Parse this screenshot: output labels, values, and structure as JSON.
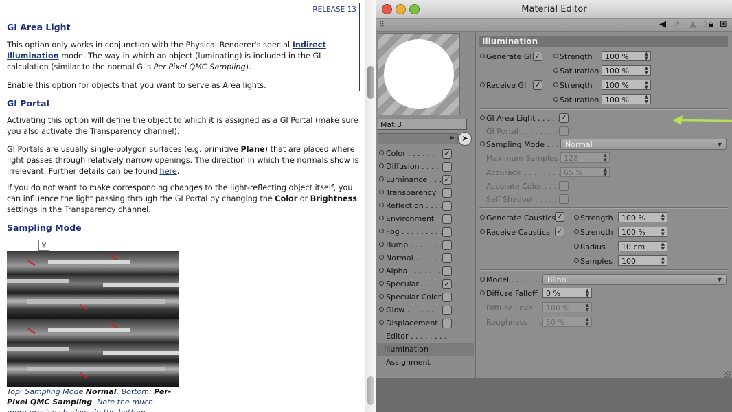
{
  "doc": {
    "release": "RELEASE 13",
    "h_area": "GI Area Light",
    "p1a": "This option only works in conjunction with the Physical Renderer's special ",
    "p1_link": "Indirect Illumination",
    "p1b": " mode. The way in which an object (luminating) is included in the GI calculation (similar to the normal GI's ",
    "p1_it": "Per Pixel QMC Sampling",
    "p1c": ").",
    "p2": "Enable this option for objects that you want to serve as Area lights.",
    "h_portal": "GI Portal",
    "p3": "Activating this option will define the object to which it is assigned as a GI Portal (make sure you also activate the Transparency channel).",
    "p4a": "GI Portals are usually single-polygon surfaces (e.g. primitive ",
    "p4_b": "Plane",
    "p4b": ") that are placed where light passes through relatively narrow openings. The direction in which the normals show is irrelevant. Further details can be found ",
    "p4_link": "here",
    "p4c": ".",
    "p5a": "If you do not want to make corresponding changes to the light-reflecting object itself, you can influence the light passing through the GI Portal by changing the ",
    "p5_b1": "Color",
    "p5_or": " or ",
    "p5_b2": "Brightness",
    "p5b": " settings in the Transparency channel.",
    "h_sampling": "Sampling Mode",
    "cap_a": "Top: Sampling Mode ",
    "cap_b1": "Normal",
    "cap_c": ". Bottom: ",
    "cap_b2": "Per-Pixel QMC Sampling",
    "cap_d": ". Note the much more precise shadows in the bottom example."
  },
  "window": {
    "title": "Material Editor",
    "material_name": "Mat.3",
    "checkmark": "✓",
    "check_off": "",
    "colors": {
      "arrow": "#b6e05a",
      "close": "#e8564e",
      "minimize": "#e9b13a",
      "zoom": "#7fc044"
    }
  },
  "channels": [
    {
      "label": "Color . . . . . .",
      "checked": true
    },
    {
      "label": "Diffusion . . . . .",
      "checked": false
    },
    {
      "label": "Luminance . . .",
      "checked": true
    },
    {
      "label": "Transparency",
      "checked": false
    },
    {
      "label": "Reflection . . . .",
      "checked": false
    },
    {
      "label": "Environment",
      "checked": false
    },
    {
      "label": "Fog . . . . . . . . .",
      "checked": false
    },
    {
      "label": "Bump . . . . . . .",
      "checked": false
    },
    {
      "label": "Normal . . . . . .",
      "checked": false
    },
    {
      "label": "Alpha . . . . . . .",
      "checked": false
    },
    {
      "label": "Specular . . . . .",
      "checked": true
    },
    {
      "label": "Specular Color",
      "checked": false
    },
    {
      "label": "Glow . . . . . . . .",
      "checked": false
    },
    {
      "label": "Displacement",
      "checked": false
    }
  ],
  "extra_items": {
    "editor": "Editor . . . . . . . .",
    "illumination": "Illumination",
    "assignment": "Assignment"
  },
  "illum": {
    "title": "Illumination",
    "generate_gi": "Generate GI",
    "receive_gi": "Receive GI",
    "strength": "Strength",
    "saturation": "Saturation",
    "v100": "100 %",
    "gi_area_light": "GI Area Light . . . . .",
    "gi_portal": "GI Portal . . . . . . . . .",
    "sampling_mode": "Sampling Mode . . .",
    "sampling_value": "Normal",
    "max_samples": "Maximum Samples",
    "max_samples_val": "128",
    "accuracy": "Accuracy. . . . . . . . .",
    "accuracy_val": "65 %",
    "accurate_color": "Accurate Color . . .",
    "self_shadow": "Self Shadow . . . . . .",
    "generate_caustics": "Generate Caustics",
    "receive_caustics": "Receive Caustics",
    "radius": "Radius",
    "radius_val": "10 cm",
    "samples": "Samples",
    "samples_val": "100",
    "model": "Model . . . . . . . .",
    "model_val": "Blinn",
    "diffuse_falloff": "Diffuse Falloff",
    "diffuse_falloff_val": "0 %",
    "diffuse_level": "Diffuse Level",
    "diffuse_level_val": "100 %",
    "roughness": "Roughness . . . .",
    "roughness_val": "50 %"
  }
}
